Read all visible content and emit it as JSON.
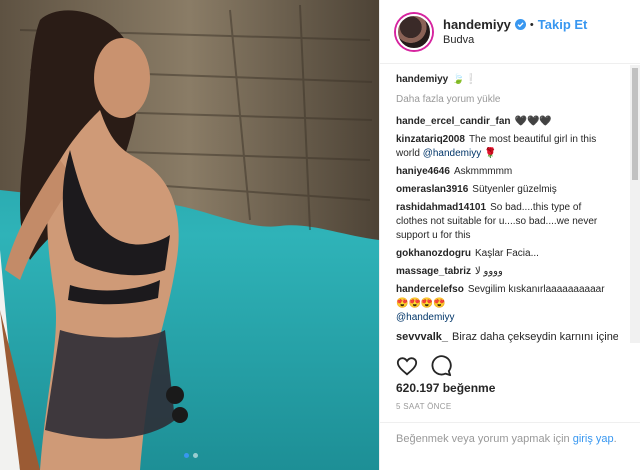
{
  "post": {
    "username": "handemiyy",
    "follow_label": "Takip Et",
    "separator": "•",
    "location": "Budva",
    "verified_color": "#3897f0"
  },
  "caption": {
    "username": "handemiyy",
    "text": "🍃❕"
  },
  "load_more": "Daha fazla yorum yükle",
  "comments": [
    {
      "user": "hande_ercel_candir_fan",
      "text": "🖤🖤🖤"
    },
    {
      "user": "kinzatariq2008",
      "text": "The most beautiful girl in this world",
      "mention": "@handemiyy",
      "tail": "🌹"
    },
    {
      "user": "haniye4646",
      "text": "Askmmmmm"
    },
    {
      "user": "omeraslan3916",
      "text": "Sütyenler güzelmiş"
    },
    {
      "user": "rashidahmad14101",
      "text": "So bad....this type of clothes not suitable for u....so bad....we never support u for this"
    },
    {
      "user": "gokhanozdogru",
      "text": "Kaşlar Facia..."
    },
    {
      "user": "massage_tabriz",
      "text": "وووو ﻻ"
    },
    {
      "user": "handercelefso",
      "text": "Sevgilim kıskanırlaaaaaaaaaar 😍😍😍😍",
      "mention": "@handemiyy"
    }
  ],
  "last_comment": {
    "user": "sevvvalk_",
    "text": "Biraz daha çekseydin karnını içine"
  },
  "likes": "620.197 beğenme",
  "time": "5 SAAT ÖNCE",
  "footer": {
    "prefix": "Beğenmek veya yorum yapmak için",
    "link": "giriş yap",
    "suffix": "."
  }
}
